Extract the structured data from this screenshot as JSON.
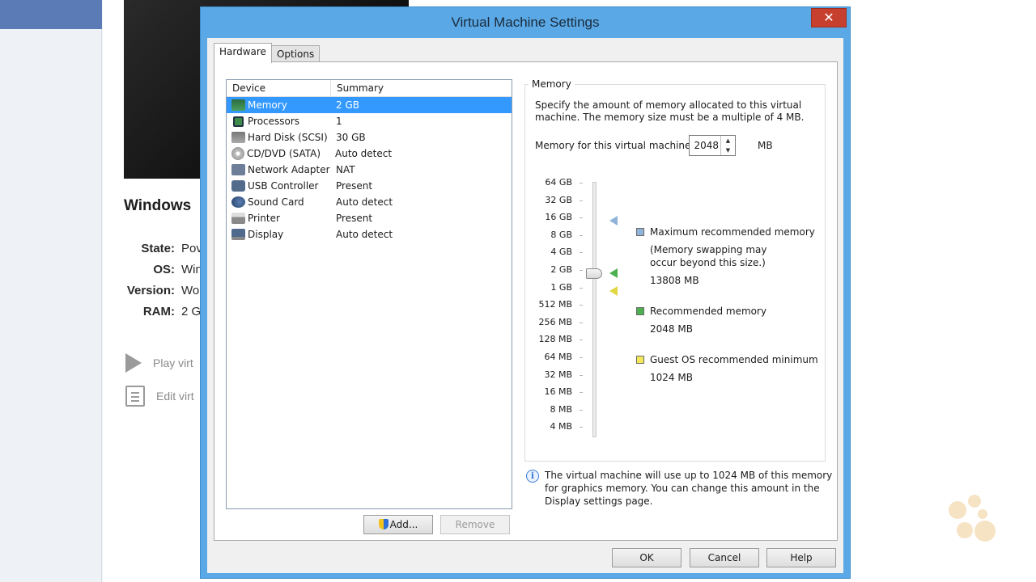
{
  "background": {
    "vm_title": "Windows",
    "properties": [
      {
        "key": "State:",
        "value": "Pov"
      },
      {
        "key": "OS:",
        "value": "Win"
      },
      {
        "key": "Version:",
        "value": "Wo"
      },
      {
        "key": "RAM:",
        "value": "2 G"
      }
    ],
    "actions": {
      "play": "Play virt",
      "edit": "Edit virt"
    }
  },
  "dialog": {
    "title": "Virtual Machine Settings",
    "close_label": "✕",
    "tabs": [
      {
        "label": "Hardware",
        "active": true
      },
      {
        "label": "Options",
        "active": false
      }
    ],
    "device_list": {
      "columns": {
        "device": "Device",
        "summary": "Summary"
      },
      "rows": [
        {
          "name": "Memory",
          "summary": "2 GB",
          "icon": "memory-icon",
          "selected": true
        },
        {
          "name": "Processors",
          "summary": "1",
          "icon": "processor-icon"
        },
        {
          "name": "Hard Disk (SCSI)",
          "summary": "30 GB",
          "icon": "hard-disk-icon"
        },
        {
          "name": "CD/DVD (SATA)",
          "summary": "Auto detect",
          "icon": "cd-dvd-icon"
        },
        {
          "name": "Network Adapter",
          "summary": "NAT",
          "icon": "network-adapter-icon"
        },
        {
          "name": "USB Controller",
          "summary": "Present",
          "icon": "usb-icon"
        },
        {
          "name": "Sound Card",
          "summary": "Auto detect",
          "icon": "sound-card-icon"
        },
        {
          "name": "Printer",
          "summary": "Present",
          "icon": "printer-icon"
        },
        {
          "name": "Display",
          "summary": "Auto detect",
          "icon": "display-icon"
        }
      ]
    },
    "add_button": "Add...",
    "remove_button": "Remove",
    "memory": {
      "group_title": "Memory",
      "description": "Specify the amount of memory allocated to this virtual machine. The memory size must be a multiple of 4 MB.",
      "field_label": "Memory for this virtual machine:",
      "value": "2048",
      "unit": "MB",
      "scale": [
        "64 GB",
        "32 GB",
        "16 GB",
        "8 GB",
        "4 GB",
        "2 GB",
        "1 GB",
        "512 MB",
        "256 MB",
        "128 MB",
        "64 MB",
        "32 MB",
        "16 MB",
        "8 MB",
        "4 MB"
      ],
      "legend": [
        {
          "title": "Maximum recommended memory",
          "note": "(Memory swapping may occur beyond this size.)",
          "value": "13808 MB",
          "color": "#8fb3d9"
        },
        {
          "title": "Recommended memory",
          "value": "2048 MB",
          "color": "#4caf50"
        },
        {
          "title": "Guest OS recommended minimum",
          "value": "1024 MB",
          "color": "#f4e85a"
        }
      ],
      "info": "The virtual machine will use up to 1024 MB of this memory for graphics memory. You can change this amount in the Display settings page."
    },
    "buttons": {
      "ok": "OK",
      "cancel": "Cancel",
      "help": "Help"
    }
  }
}
